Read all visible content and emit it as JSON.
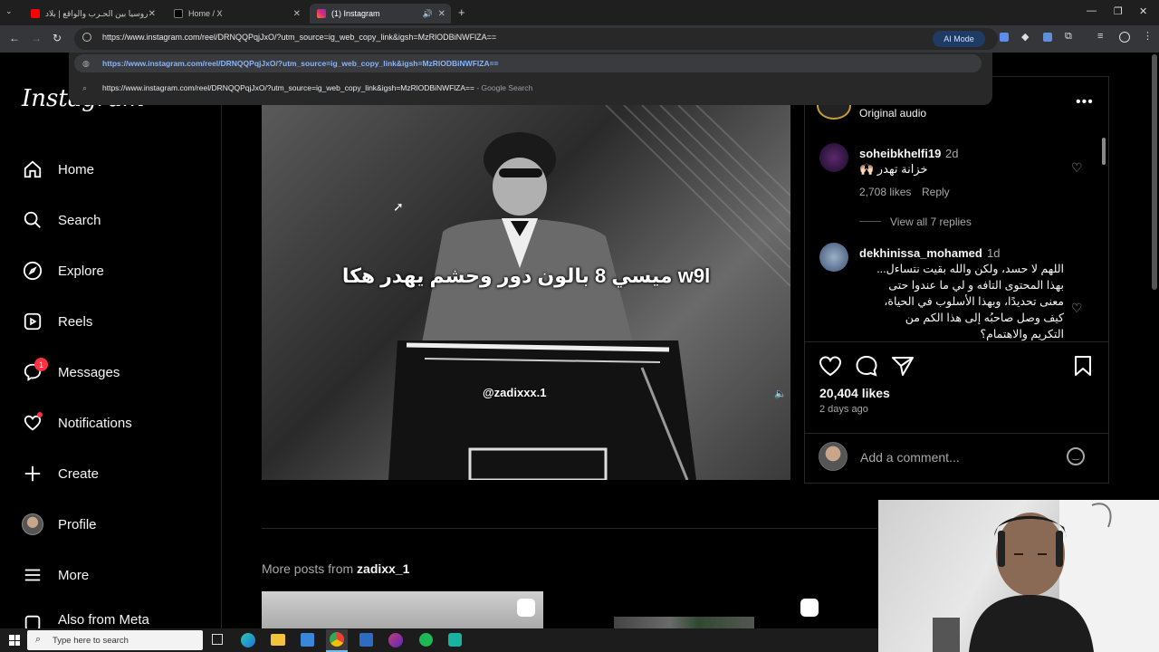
{
  "browser": {
    "tabs": [
      {
        "title": "روسيا بين الحـرب والواقع | بلاد",
        "color": "#ff0000"
      },
      {
        "title": "Home / X",
        "color": "#ffffff"
      },
      {
        "title": "(1) Instagram",
        "color": "#e1306c"
      }
    ],
    "new_tab": "+",
    "url": "https://www.instagram.com/reel/DRNQQPqjJxO/?utm_source=ig_web_copy_link&igsh=MzRlODBiNWFlZA==",
    "ai_mode": "AI Mode",
    "suggestions": [
      {
        "text": "https://www.instagram.com/reel/DRNQQPqjJxO/?utm_source=ig_web_copy_link&igsh=MzRlODBiNWFlZA=="
      },
      {
        "text": "https://www.instagram.com/reel/DRNQQPqjJxO/?utm_source=ig_web_copy_link&igsh=MzRlODBiNWFlZA==",
        "suffix": " - Google Search"
      }
    ]
  },
  "instagram": {
    "logo": "Instagram",
    "nav": [
      {
        "label": "Home",
        "icon": "home-icon"
      },
      {
        "label": "Search",
        "icon": "search-icon"
      },
      {
        "label": "Explore",
        "icon": "compass-icon"
      },
      {
        "label": "Reels",
        "icon": "reels-icon"
      },
      {
        "label": "Messages",
        "icon": "messenger-icon",
        "badge": "1"
      },
      {
        "label": "Notifications",
        "icon": "heart-icon"
      },
      {
        "label": "Create",
        "icon": "plus-icon"
      },
      {
        "label": "Profile",
        "icon": "avatar-icon"
      },
      {
        "label": "More",
        "icon": "menu-icon"
      },
      {
        "label": "Also from Meta",
        "icon": "meta-icon"
      }
    ],
    "video": {
      "caption": "ميسي 8 بالون دور وحشم يهدر هكا w9l",
      "watermark": "@zadixxx.1"
    },
    "panel": {
      "audio": "Original audio",
      "comments": [
        {
          "user": "soheibkhelfi19",
          "time": "2d",
          "text": "خزانة تهدر 🙌🏻",
          "likes": "2,708 likes",
          "reply": "Reply",
          "view_replies": "View all 7 replies"
        },
        {
          "user": "dekhinissa_mohamed",
          "time": "1d",
          "lines": [
            "اللهم لا حسد، ولكن والله بقيت نتساءل...",
            "بهذا المحتوى التافه و لي ما عندوا حتى",
            "معنى تحديدًا، وبهذا الأسلوب في الحياة،",
            "كيف وصل صاحبُه إلى هذا الكم من",
            "التكريم والاهتمام؟"
          ]
        }
      ],
      "likes": "20,404 likes",
      "time_ago": "2 days ago",
      "comment_placeholder": "Add a comment..."
    },
    "more_posts": {
      "prefix": "More posts from ",
      "user": "zadixx_1"
    }
  },
  "taskbar": {
    "search_placeholder": "Type here to search"
  },
  "colors": {
    "accent_red": "#ff3040",
    "link_blue": "#8ab4f8"
  }
}
